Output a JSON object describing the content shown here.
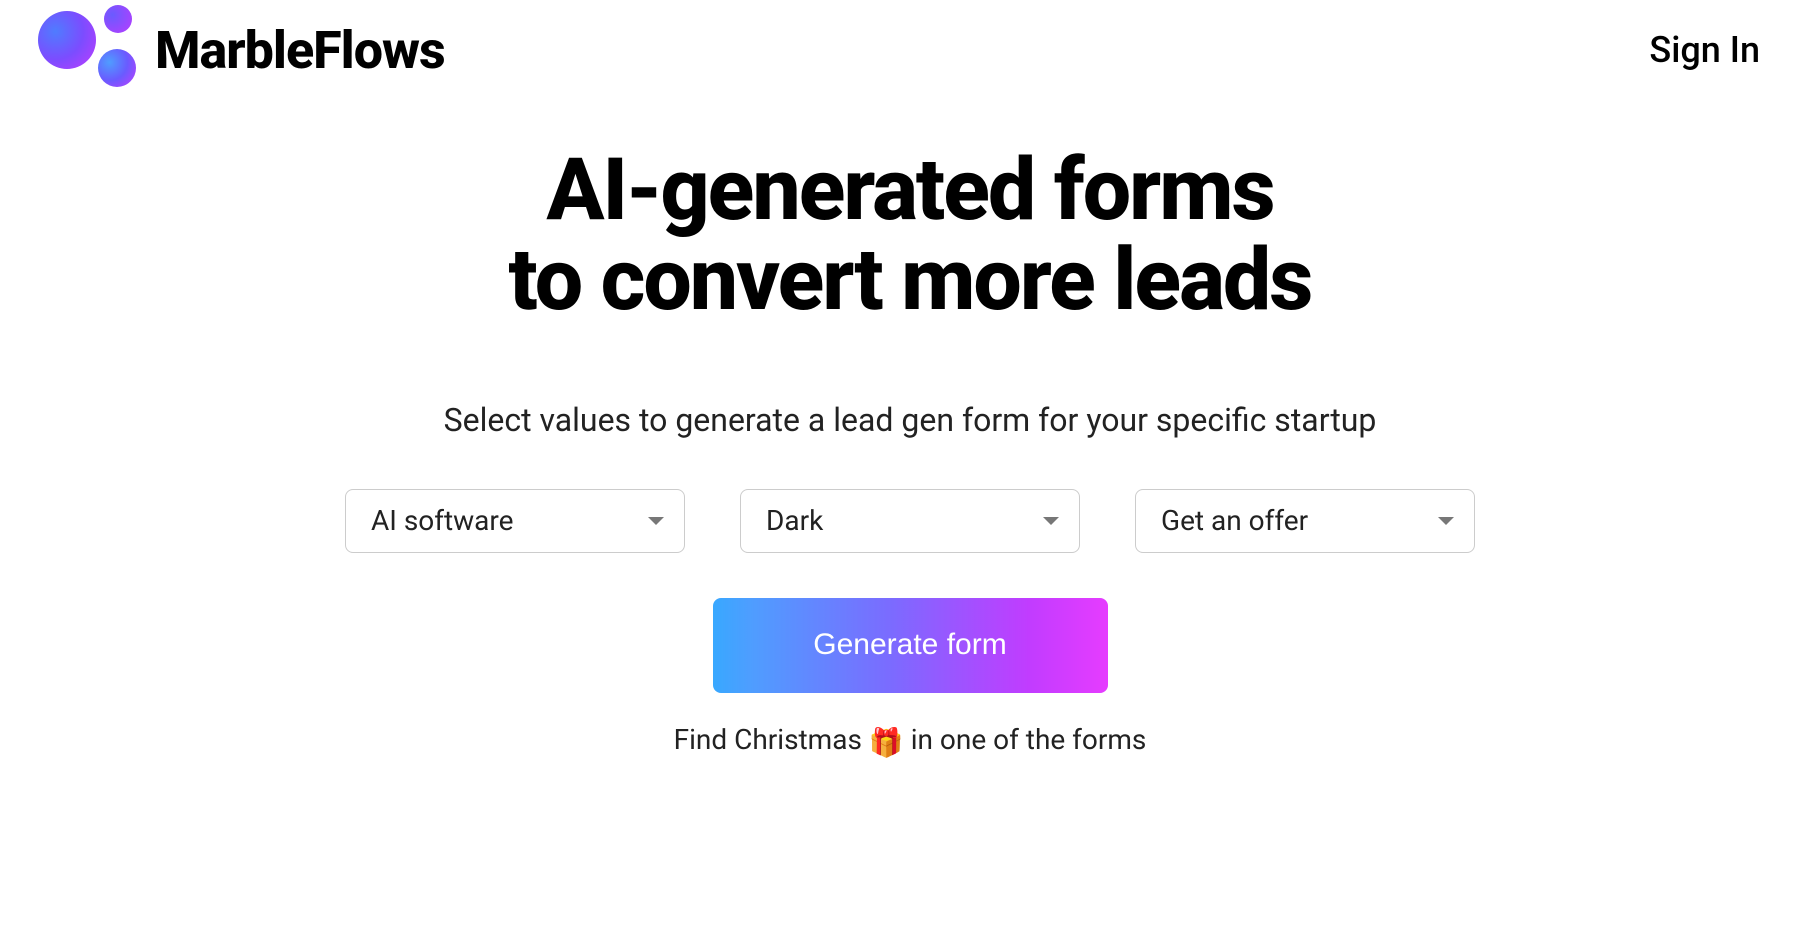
{
  "header": {
    "brand_name": "MarbleFlows",
    "signin_label": "Sign In"
  },
  "hero": {
    "title_line1": "AI-generated forms",
    "title_line2": "to convert more leads",
    "subtitle": "Select values to generate a lead gen form for your specific startup"
  },
  "selects": {
    "category": {
      "value": "AI software"
    },
    "theme": {
      "value": "Dark"
    },
    "cta": {
      "value": "Get an offer"
    }
  },
  "actions": {
    "generate_label": "Generate form"
  },
  "footnote": {
    "prefix": "Find Christmas ",
    "emoji": "🎁",
    "suffix": " in one of the forms"
  }
}
